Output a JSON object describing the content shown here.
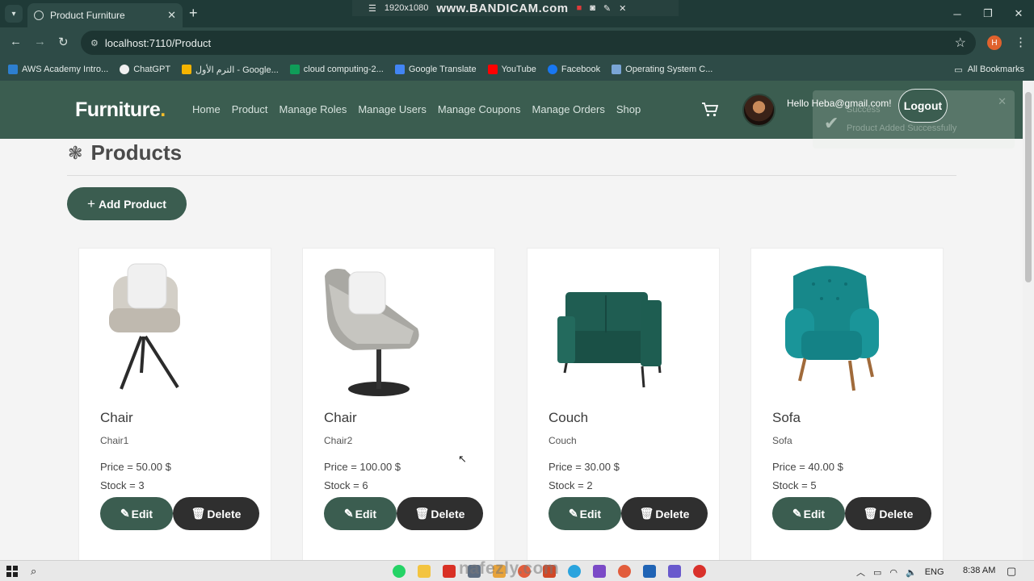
{
  "browser": {
    "tab_title": "Product Furniture",
    "url": "localhost:7110/Product",
    "profile_initial": "H",
    "bookmarks": [
      {
        "label": "AWS Academy Intro...",
        "icon": "cloud-icon",
        "color": "#2d7fd0"
      },
      {
        "label": "ChatGPT",
        "icon": "chatgpt-icon",
        "color": "#f0f0f0"
      },
      {
        "label": "الترم الأول - Google...",
        "icon": "drive-icon",
        "color": "#f4b400"
      },
      {
        "label": "cloud computing-2...",
        "icon": "drive-icon",
        "color": "#0f9d58"
      },
      {
        "label": "Google Translate",
        "icon": "translate-icon",
        "color": "#4285f4"
      },
      {
        "label": "YouTube",
        "icon": "youtube-icon",
        "color": "#ff0000"
      },
      {
        "label": "Facebook",
        "icon": "facebook-icon",
        "color": "#1877f2"
      },
      {
        "label": "Operating System C...",
        "icon": "page-icon",
        "color": "#7aa5d6"
      }
    ],
    "all_bookmarks": "All Bookmarks"
  },
  "recorder": {
    "resolution": "1920x1080",
    "brand": "www.BANDICAM.com"
  },
  "navbar": {
    "logo": "Furniture",
    "logo_dot": ".",
    "links": [
      "Home",
      "Product",
      "Manage Roles",
      "Manage Users",
      "Manage Coupons",
      "Manage Orders",
      "Shop"
    ],
    "greeting": "Hello Heba@gmail.com!",
    "logout": "Logout"
  },
  "toast": {
    "title": "Success",
    "message": "Product Added Successfully"
  },
  "page": {
    "title": "Products",
    "add_button": "Add Product"
  },
  "products": [
    {
      "name": "Chair",
      "description": "Chair1",
      "price": "Price = 50.00 $",
      "stock": "Stock = 3",
      "edit": "Edit",
      "delete": "Delete"
    },
    {
      "name": "Chair",
      "description": "Chair2",
      "price": "Price = 100.00 $",
      "stock": "Stock = 6",
      "edit": "Edit",
      "delete": "Delete"
    },
    {
      "name": "Couch",
      "description": "Couch",
      "price": "Price = 30.00 $",
      "stock": "Stock = 2",
      "edit": "Edit",
      "delete": "Delete"
    },
    {
      "name": "Sofa",
      "description": "Sofa",
      "price": "Price = 40.00 $",
      "stock": "Stock = 5",
      "edit": "Edit",
      "delete": "Delete"
    }
  ],
  "taskbar": {
    "language": "ENG",
    "time": "8:38 AM"
  },
  "watermark": "nafezly.com"
}
